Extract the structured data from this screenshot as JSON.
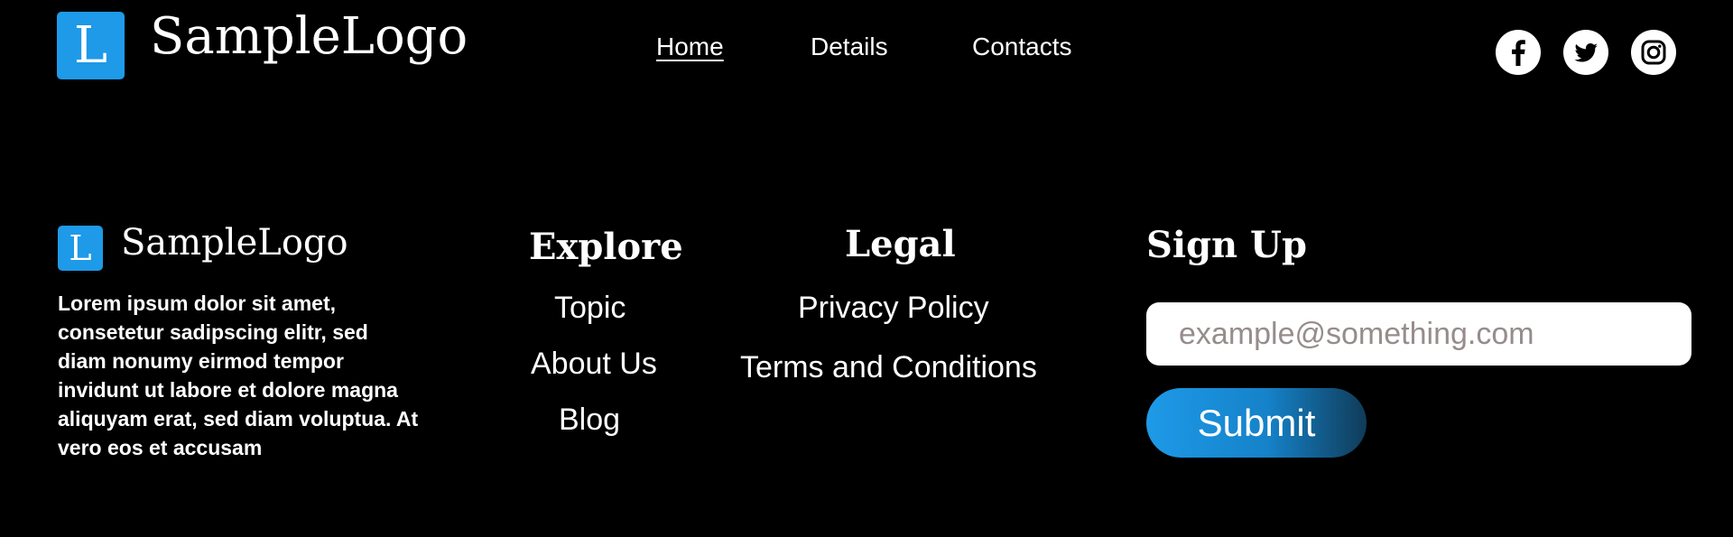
{
  "header": {
    "logo_letter": "L",
    "logo_text": "SampleLogo",
    "nav": [
      {
        "label": "Home",
        "active": true
      },
      {
        "label": "Details",
        "active": false
      },
      {
        "label": "Contacts",
        "active": false
      }
    ],
    "social": [
      "facebook-icon",
      "twitter-icon",
      "instagram-icon"
    ]
  },
  "footer": {
    "brand": {
      "logo_letter": "L",
      "logo_text": "SampleLogo",
      "description": "Lorem ipsum dolor sit amet, consetetur sadipscing elitr, sed diam nonumy eirmod tempor invidunt ut labore et dolore magna aliquyam erat, sed diam voluptua. At vero eos et accusam"
    },
    "explore": {
      "heading": "Explore",
      "links": [
        "Topic",
        "About Us",
        "Blog"
      ]
    },
    "legal": {
      "heading": "Legal",
      "links": [
        "Privacy Policy",
        "Terms and Conditions"
      ]
    },
    "signup": {
      "heading": "Sign Up",
      "email_placeholder": "example@something.com",
      "email_value": "",
      "submit_label": "Submit"
    }
  },
  "colors": {
    "background": "#000000",
    "accent": "#1e9ae8",
    "accent_dark": "#103b58",
    "placeholder": "#978c8c"
  }
}
